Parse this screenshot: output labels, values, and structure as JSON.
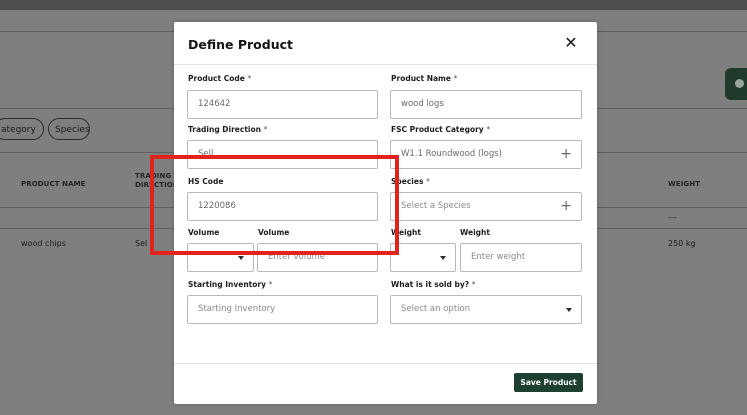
{
  "background": {
    "filter_chips": [
      "ategory",
      "Species"
    ],
    "table_headers": {
      "product_name": "PRODUCT NAME",
      "trading_direction": "TRADING DIRECTION",
      "weight": "WEIGHT"
    },
    "row_empty_weight": "---",
    "row": {
      "product_name": "wood chips",
      "trading_direction": "Sel",
      "weight": "250 kg"
    }
  },
  "modal": {
    "title": "Define Product",
    "close_glyph": "✕",
    "product_code": {
      "label": "Product Code",
      "value": "124642"
    },
    "product_name": {
      "label": "Product Name",
      "value": "wood logs"
    },
    "trading_direction": {
      "label": "Trading Direction",
      "value": "Sell"
    },
    "fsc_category": {
      "label": "FSC Product Category",
      "value": "W1.1 Roundwood (logs)"
    },
    "hs_code": {
      "label": "HS Code",
      "value": "1220086"
    },
    "species": {
      "label": "Species",
      "placeholder": "Select a Species"
    },
    "volume_unit": {
      "label": "Volume"
    },
    "volume": {
      "label": "Volume",
      "placeholder": "Enter volume"
    },
    "weight_unit": {
      "label": "Weight"
    },
    "weight": {
      "label": "Weight",
      "placeholder": "Enter weight"
    },
    "starting_inventory": {
      "label": "Starting Inventory",
      "placeholder": "Starting Inventory"
    },
    "sold_by": {
      "label": "What is it sold by?",
      "placeholder": "Select an option"
    },
    "required_mark": "*",
    "save_label": "Save Product"
  },
  "colors": {
    "accent": "#1e4030",
    "highlight": "#e2231a"
  },
  "icons": {
    "close": "close-icon",
    "add": "plus-icon",
    "dropdown": "chevron-down-icon"
  }
}
